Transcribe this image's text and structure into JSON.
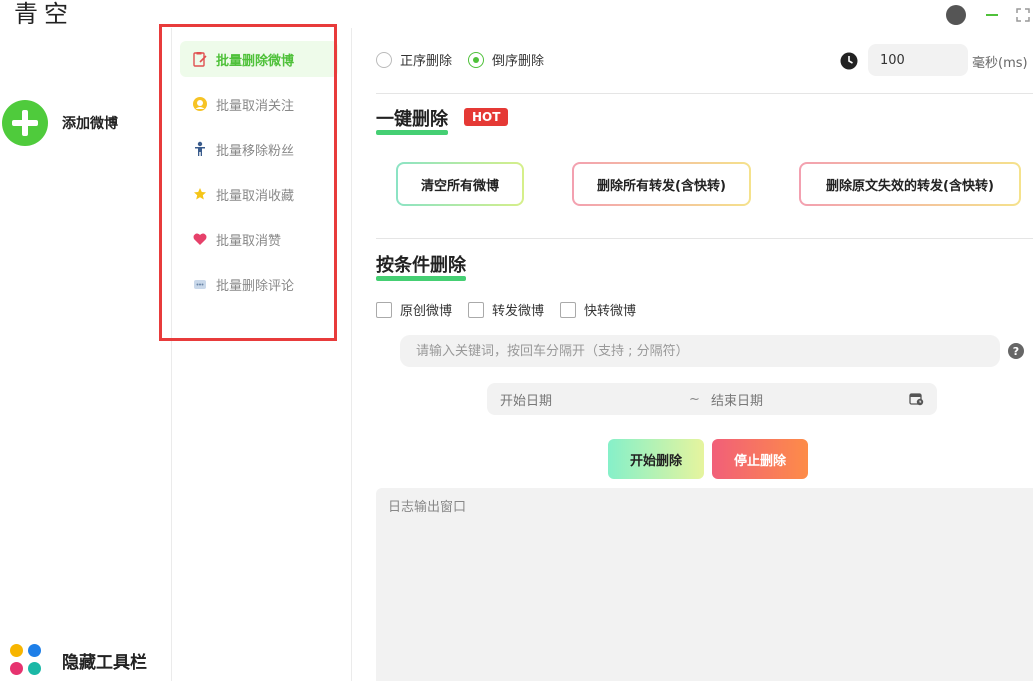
{
  "app": {
    "title": "青空"
  },
  "left_sidebar": {
    "add_weibo_label": "添加微博",
    "hide_toolbar_label": "隐藏工具栏",
    "dot_colors": [
      "#f7b500",
      "#1e7fe8",
      "#e6336f",
      "#1bb8a6"
    ]
  },
  "menu": {
    "items": [
      {
        "label": "批量删除微博",
        "icon": "clipboard-edit-icon",
        "active": true
      },
      {
        "label": "批量取消关注",
        "icon": "user-circle-icon",
        "active": false
      },
      {
        "label": "批量移除粉丝",
        "icon": "person-icon",
        "active": false
      },
      {
        "label": "批量取消收藏",
        "icon": "star-icon",
        "active": false
      },
      {
        "label": "批量取消赞",
        "icon": "heart-icon",
        "active": false
      },
      {
        "label": "批量删除评论",
        "icon": "comment-icon",
        "active": false
      }
    ]
  },
  "main": {
    "order": {
      "forward_label": "正序删除",
      "reverse_label": "倒序删除",
      "selected": "reverse"
    },
    "interval": {
      "value": "100",
      "unit": "毫秒(ms)"
    },
    "one_click": {
      "title": "一键删除",
      "badge": "HOT",
      "buttons": [
        "清空所有微博",
        "删除所有转发(含快转)",
        "删除原文失效的转发(含快转)"
      ]
    },
    "conditional": {
      "title": "按条件删除",
      "checkboxes": [
        "原创微博",
        "转发微博",
        "快转微博"
      ],
      "keyword_placeholder": "请输入关键词，按回车分隔开（支持 ; 分隔符）",
      "help_glyph": "?",
      "date_start_placeholder": "开始日期",
      "date_separator": "~",
      "date_end_placeholder": "结束日期",
      "start_button": "开始删除",
      "stop_button": "停止删除"
    },
    "log_placeholder": "日志输出窗口"
  },
  "colors": {
    "accent_green": "#4fc13a",
    "section_underline": "#45cf73",
    "hot_red": "#e53935",
    "annotation_red": "#e83b3b"
  }
}
